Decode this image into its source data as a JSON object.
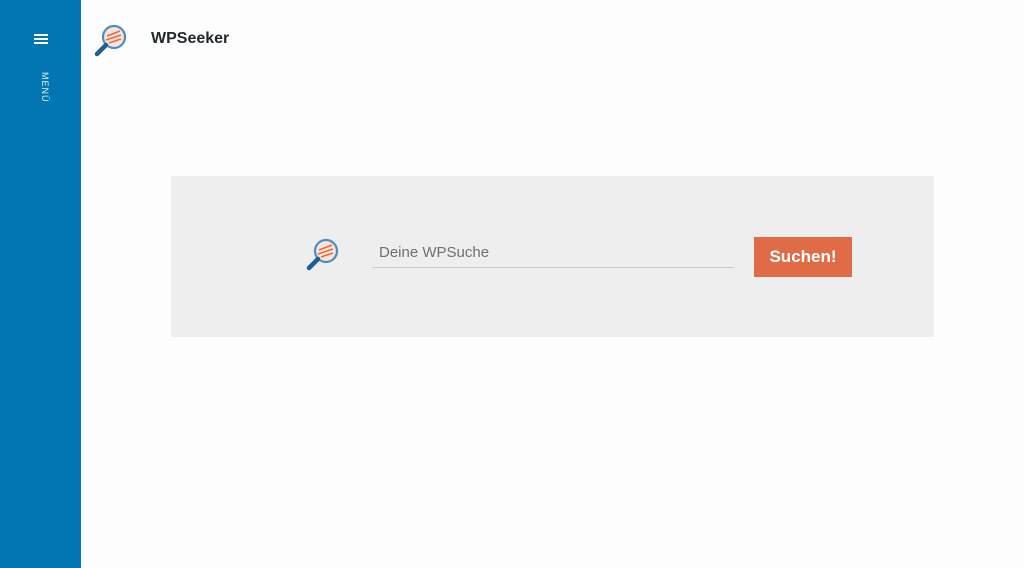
{
  "sidebar": {
    "menu_icon": "hamburger-icon",
    "menu_label": "MENÜ",
    "background_color": "#0275b3"
  },
  "header": {
    "logo_icon": "magnifier-logo-icon",
    "site_title": "WPSeeker"
  },
  "search": {
    "logo_icon": "magnifier-logo-icon",
    "placeholder": "Deine WPSuche",
    "value": "",
    "button_label": "Suchen!",
    "button_color": "#e06c47",
    "panel_color": "#eeeeee"
  }
}
